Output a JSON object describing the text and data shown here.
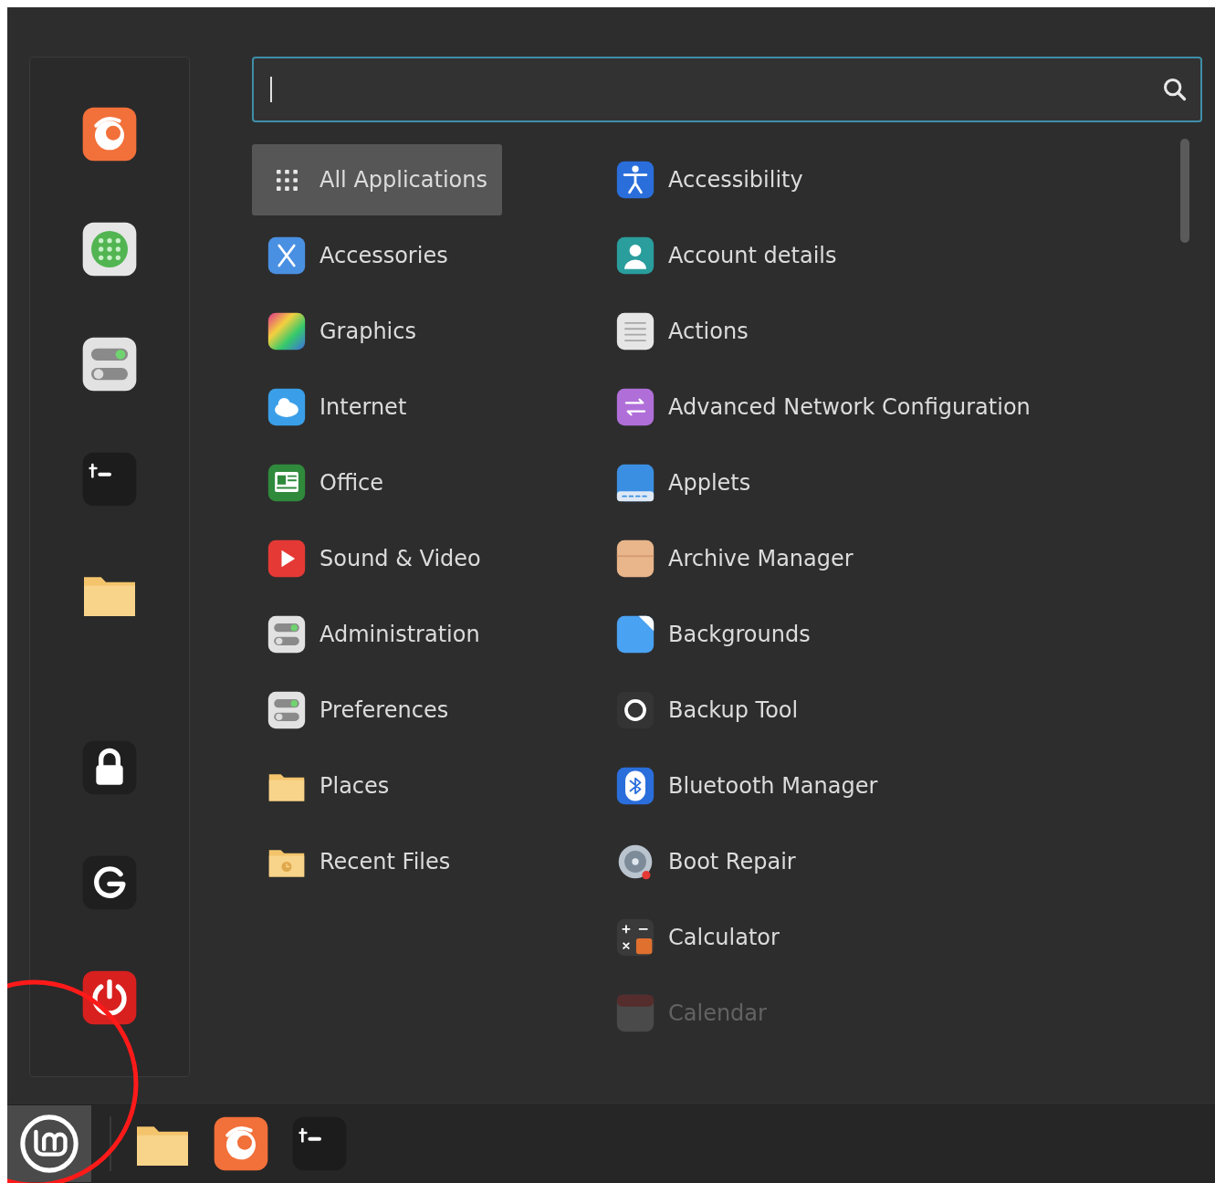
{
  "categories": [
    {
      "label": "All Applications",
      "selected": true
    },
    {
      "label": "Accessories",
      "selected": false
    },
    {
      "label": "Graphics",
      "selected": false
    },
    {
      "label": "Internet",
      "selected": false
    },
    {
      "label": "Office",
      "selected": false
    },
    {
      "label": "Sound & Video",
      "selected": false
    },
    {
      "label": "Administration",
      "selected": false
    },
    {
      "label": "Preferences",
      "selected": false
    },
    {
      "label": "Places",
      "selected": false
    },
    {
      "label": "Recent Files",
      "selected": false
    }
  ],
  "applications": [
    {
      "label": "Accessibility",
      "faded": false
    },
    {
      "label": "Account details",
      "faded": false
    },
    {
      "label": "Actions",
      "faded": false
    },
    {
      "label": "Advanced Network Configuration",
      "faded": false
    },
    {
      "label": "Applets",
      "faded": false
    },
    {
      "label": "Archive Manager",
      "faded": false
    },
    {
      "label": "Backgrounds",
      "faded": false
    },
    {
      "label": "Backup Tool",
      "faded": false
    },
    {
      "label": "Bluetooth Manager",
      "faded": false
    },
    {
      "label": "Boot Repair",
      "faded": false
    },
    {
      "label": "Calculator",
      "faded": false
    },
    {
      "label": "Calendar",
      "faded": true
    }
  ]
}
